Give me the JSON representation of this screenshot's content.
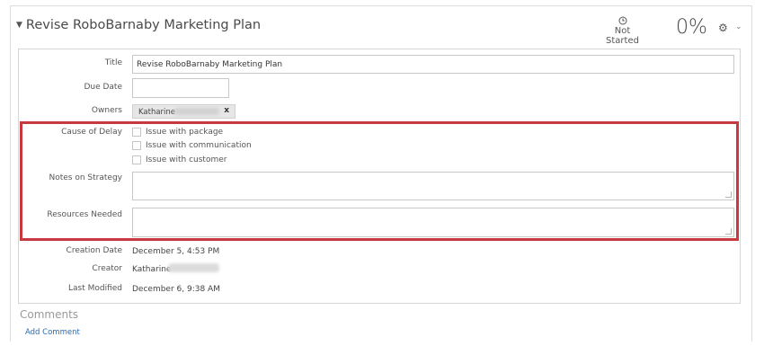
{
  "task": {
    "title": "Revise RoboBarnaby Marketing Plan",
    "status": "Not Started",
    "percent": "0%"
  },
  "icons": {
    "caret": "caret-down-icon",
    "clock": "clock-icon",
    "gear": "gear-icon",
    "chevron": "chevron-down-icon"
  },
  "fields": {
    "title_label": "Title",
    "title_value": "Revise RoboBarnaby Marketing Plan",
    "due_date_label": "Due Date",
    "due_date_value": "",
    "owners_label": "Owners",
    "owner_name": "Katharine",
    "owner_remove": "x",
    "cause_label": "Cause of Delay",
    "cause_options": [
      "Issue with package",
      "Issue with communication",
      "Issue with customer"
    ],
    "notes_label": "Notes on Strategy",
    "notes_value": "",
    "resources_label": "Resources Needed",
    "resources_value": "",
    "creation_label": "Creation Date",
    "creation_value": "December 5, 4:53 PM",
    "creator_label": "Creator",
    "creator_value": "Katharine",
    "modified_label": "Last Modified",
    "modified_value": "December 6, 9:38 AM"
  },
  "comments": {
    "heading": "Comments",
    "add_label": "Add Comment"
  },
  "colors": {
    "highlight": "#c6393f",
    "link": "#2b6cb0"
  }
}
